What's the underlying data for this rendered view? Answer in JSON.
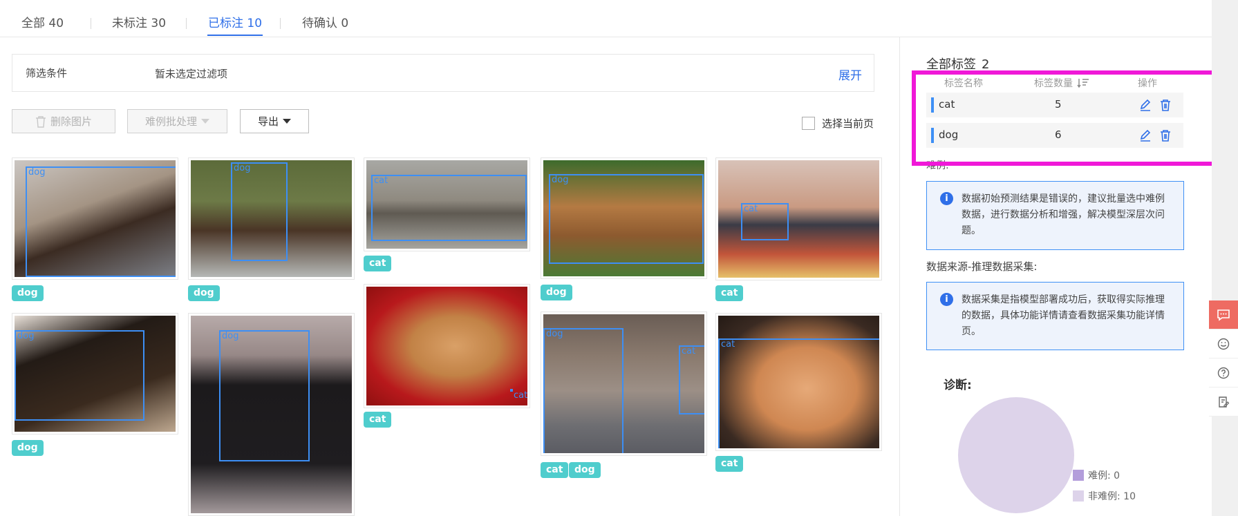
{
  "tabs": [
    {
      "label": "全部 40",
      "active": false
    },
    {
      "label": "未标注 30",
      "active": false
    },
    {
      "label": "已标注 10",
      "active": true
    },
    {
      "label": "待确认 0",
      "active": false
    }
  ],
  "filter": {
    "label": "筛选条件",
    "value": "暂未选定过滤项",
    "expand": "展开"
  },
  "toolbar": {
    "delete": "删除图片",
    "batch": "难例批处理",
    "export": "导出",
    "select_page": "选择当前页"
  },
  "gallery": [
    {
      "boxes": [
        "dog"
      ],
      "tags": [
        "dog"
      ]
    },
    {
      "boxes": [
        "dog"
      ],
      "tags": [
        "dog"
      ]
    },
    {
      "boxes": [
        "cat"
      ],
      "tags": [
        "cat"
      ]
    },
    {
      "boxes": [
        "dog"
      ],
      "tags": [
        "dog"
      ]
    },
    {
      "boxes": [
        "cat"
      ],
      "tags": [
        "cat"
      ]
    },
    {
      "boxes": [
        "dog"
      ],
      "tags": [
        "dog"
      ]
    },
    {
      "boxes": [
        "dog"
      ],
      "tags": []
    },
    {
      "boxes": [
        "cat"
      ],
      "tags": [
        "cat"
      ]
    },
    {
      "boxes": [
        "dog",
        "cat"
      ],
      "tags": [
        "cat",
        "dog"
      ]
    },
    {
      "boxes": [
        "cat"
      ],
      "tags": [
        "cat"
      ]
    }
  ],
  "panel": {
    "title": "全部标签",
    "total": "2",
    "headers": {
      "name": "标签名称",
      "count": "标签数量",
      "action": "操作"
    },
    "labels": [
      {
        "name": "cat",
        "count": "5"
      },
      {
        "name": "dog",
        "count": "6"
      }
    ],
    "hard_example_label": "难例:",
    "info1": "数据初始预测结果是错误的，建议批量选中难例数据，进行数据分析和增强，解决模型深层次问题。",
    "source_label": "数据来源-推理数据采集:",
    "info2": "数据采集是指模型部署成功后，获取得实际推理的数据，具体功能详情请查看数据采集功能详情页。",
    "diagnosis_title": "诊断:",
    "legend": [
      {
        "label": "难例: 0",
        "color": "#b39ddb"
      },
      {
        "label": "非难例: 10",
        "color": "#ddd3ea"
      }
    ]
  },
  "chart_data": {
    "type": "pie",
    "categories": [
      "难例",
      "非难例"
    ],
    "values": [
      0,
      10
    ],
    "title": "诊断:",
    "colors": [
      "#b39ddb",
      "#ddd3ea"
    ]
  },
  "colors": {
    "accent": "#2f6fe8",
    "tag": "#4fcdcd",
    "bbox": "#3d8ff5",
    "highlight": "#f018d8",
    "feedback": "#ee6b62"
  }
}
